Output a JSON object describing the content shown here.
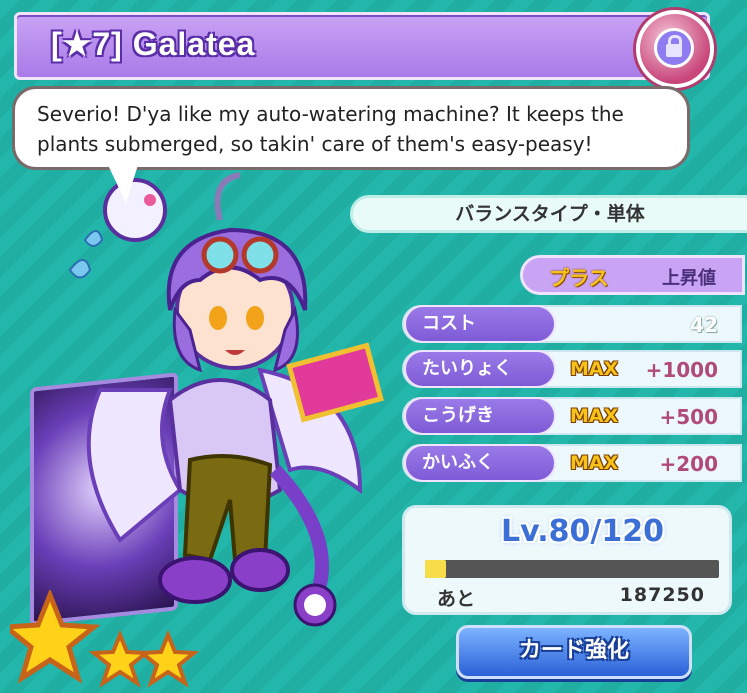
{
  "header": {
    "title": "[★7] Galatea",
    "lock_icon": "lock-icon"
  },
  "dialog": {
    "text": "Severio! D'ya like my auto-watering machine? It keeps the plants submerged, so takin' care of them's easy-peasy!"
  },
  "type_banner": "バランスタイプ・単体",
  "plus": {
    "label": "プラス",
    "value": "上昇値"
  },
  "stats": [
    {
      "label": "コスト",
      "max": "",
      "value": "42"
    },
    {
      "label": "たいりょく",
      "max": "MAX",
      "value": "+1000"
    },
    {
      "label": "こうげき",
      "max": "MAX",
      "value": "+500"
    },
    {
      "label": "かいふく",
      "max": "MAX",
      "value": "+200"
    }
  ],
  "level": {
    "text": "Lv.80/120",
    "exp_label": "あと",
    "exp_value": "187250",
    "exp_fraction": 0.07
  },
  "enhance_button": "カード強化",
  "rarity_stars": 3,
  "colors": {
    "background": "#22b3a8",
    "title_bar": "#a87ae8",
    "stat_label": "#7e5bd6",
    "max_gold": "#f7c21a",
    "level_blue": "#3b6fd6",
    "button_blue": "#2a61d8"
  }
}
